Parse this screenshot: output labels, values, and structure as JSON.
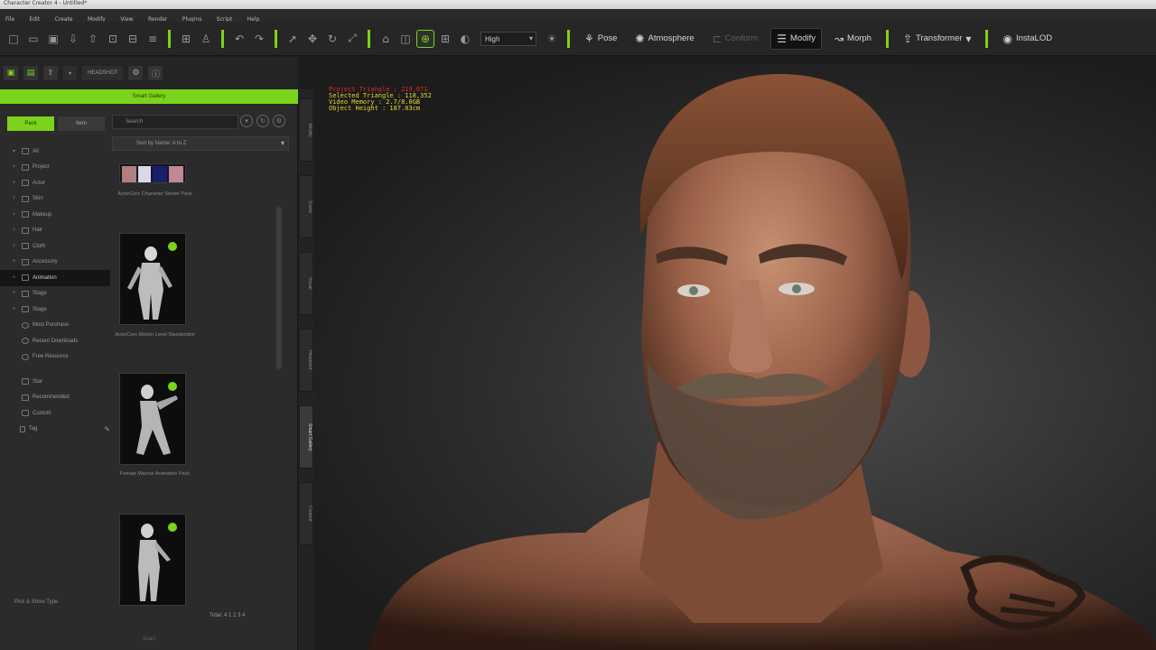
{
  "window": {
    "title": "Character Creator 4 - Untitled*"
  },
  "menu": [
    "File",
    "Edit",
    "Create",
    "Modify",
    "View",
    "Render",
    "Plugins",
    "Script",
    "Help"
  ],
  "toolbar": {
    "quality": "High",
    "modes": {
      "pose": "Pose",
      "atmosphere": "Atmosphere",
      "conform": "Conform",
      "modify": "Modify",
      "morph": "Morph",
      "transformer": "Transformer",
      "instalod": "InstaLOD"
    }
  },
  "toolbar2": {
    "headshot": "HEADSHOT"
  },
  "left_panel": {
    "header": "Smart Gallery",
    "tabs": [
      "Pack",
      "Item"
    ],
    "search_placeholder": "Search",
    "tree": [
      "All",
      "Project",
      "Actor",
      "Skin",
      "Makeup",
      "Hair",
      "Cloth",
      "Accessory",
      "Animation",
      "Stage",
      "Stage",
      "Most Purchase",
      "Recent Downloads",
      "Free Resource",
      "Star",
      "Recommended",
      "Custom",
      "Tag"
    ],
    "selected_tree_item": "Animation",
    "category": "Sort by Name: A to Z",
    "thumbnails": [
      {
        "caption": "ActorCore Character Starter Pack"
      },
      {
        "caption": "ActorCore Motion Level Standardize"
      },
      {
        "caption": "Female Warrior Animation Pack"
      },
      {
        "caption": ""
      }
    ],
    "footer_label": "Pick & Show Type",
    "pager": "Total: 4   1 2 3 4",
    "bottom_buttons": [
      "",
      "Scan",
      ""
    ]
  },
  "side_tabs": [
    "Modify",
    "Scene",
    "Visual",
    "Headshot",
    "Smart Gallery",
    "Content"
  ],
  "viewport": {
    "stats": {
      "project_triangle": "Project Triangle : 219,071",
      "selected_triangle": "Selected Triangle : 118,352",
      "video_memory": "Video Memory : 2.7/8.0GB",
      "object_height": "Object Height : 187.03cm"
    }
  },
  "colors": {
    "accent": "#7cd31b",
    "stat_red": "#e8262b",
    "stat_yellow": "#e6d82e"
  }
}
